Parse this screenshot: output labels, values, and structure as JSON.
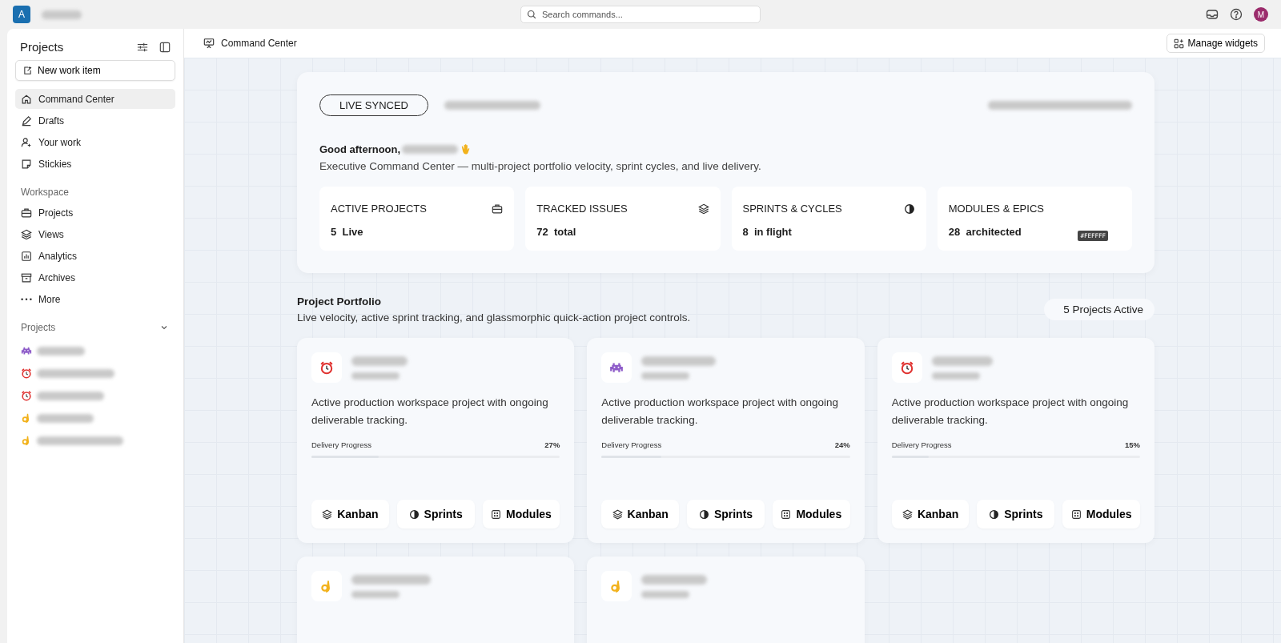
{
  "top_bar": {
    "workspace_initial": "A",
    "search": {
      "placeholder": "Search commands..."
    },
    "avatar_initial": "M"
  },
  "sidebar": {
    "title": "Projects",
    "new_item": "New work item",
    "nav": [
      {
        "label": "Command Center",
        "kind": "home",
        "selected": true
      },
      {
        "label": "Drafts",
        "kind": "pen",
        "selected": false
      },
      {
        "label": "Your work",
        "kind": "user",
        "selected": false
      },
      {
        "label": "Stickies",
        "kind": "sticky",
        "selected": false
      }
    ],
    "workspace_heading": "Workspace",
    "workspace_items": [
      {
        "label": "Projects",
        "kind": "briefcase"
      },
      {
        "label": "Views",
        "kind": "layers"
      },
      {
        "label": "Analytics",
        "kind": "chart"
      },
      {
        "label": "Archives",
        "kind": "archive"
      },
      {
        "label": "More",
        "kind": "dots"
      }
    ],
    "projects_heading": "Projects",
    "projects_expanded": true,
    "projects": [
      {
        "kind": "alien"
      },
      {
        "kind": "clock"
      },
      {
        "kind": "clock"
      },
      {
        "kind": "hand"
      },
      {
        "kind": "hand"
      }
    ]
  },
  "header": {
    "title": "Command Center",
    "manage_button": "Manage widgets"
  },
  "hero": {
    "badge": "LIVE SYNCED",
    "greeting": "Good afternoon,",
    "subtitle": "Executive Command Center — multi-project portfolio velocity, sprint cycles, and live delivery.",
    "stats": [
      {
        "label": "ACTIVE PROJECTS",
        "value": "5",
        "unit": "Live",
        "kind": "briefcase"
      },
      {
        "label": "TRACKED ISSUES",
        "value": "72",
        "unit": "total",
        "kind": "layers"
      },
      {
        "label": "SPRINTS & CYCLES",
        "value": "8",
        "unit": "in flight",
        "kind": "cycle"
      },
      {
        "label": "MODULES & EPICS",
        "value": "28",
        "unit": "architected",
        "kind": "none",
        "tooltip": "#FEFFFF"
      }
    ]
  },
  "portfolio": {
    "title": "Project Portfolio",
    "subtitle": "Live velocity, active sprint tracking, and glassmorphic quick-action project controls.",
    "count_badge": "5 Projects Active",
    "cards": [
      {
        "kind": "clock",
        "description": "Active production workspace project with ongoing deliverable tracking.",
        "progress_label": "Delivery Progress",
        "percent": "27%",
        "level": 0.27,
        "actions": [
          {
            "label": "Kanban",
            "kind": "layers"
          },
          {
            "label": "Sprints",
            "kind": "cycle"
          },
          {
            "label": "Modules",
            "kind": "grid"
          }
        ]
      },
      {
        "kind": "alien",
        "description": "Active production workspace project with ongoing deliverable tracking.",
        "progress_label": "Delivery Progress",
        "percent": "24%",
        "level": 0.24,
        "actions": [
          {
            "label": "Kanban",
            "kind": "layers"
          },
          {
            "label": "Sprints",
            "kind": "cycle"
          },
          {
            "label": "Modules",
            "kind": "grid"
          }
        ]
      },
      {
        "kind": "clock",
        "description": "Active production workspace project with ongoing deliverable tracking.",
        "progress_label": "Delivery Progress",
        "percent": "15%",
        "level": 0.15,
        "actions": [
          {
            "label": "Kanban",
            "kind": "layers"
          },
          {
            "label": "Sprints",
            "kind": "cycle"
          },
          {
            "label": "Modules",
            "kind": "grid"
          }
        ]
      },
      {
        "kind": "hand"
      },
      {
        "kind": "hand"
      }
    ]
  }
}
